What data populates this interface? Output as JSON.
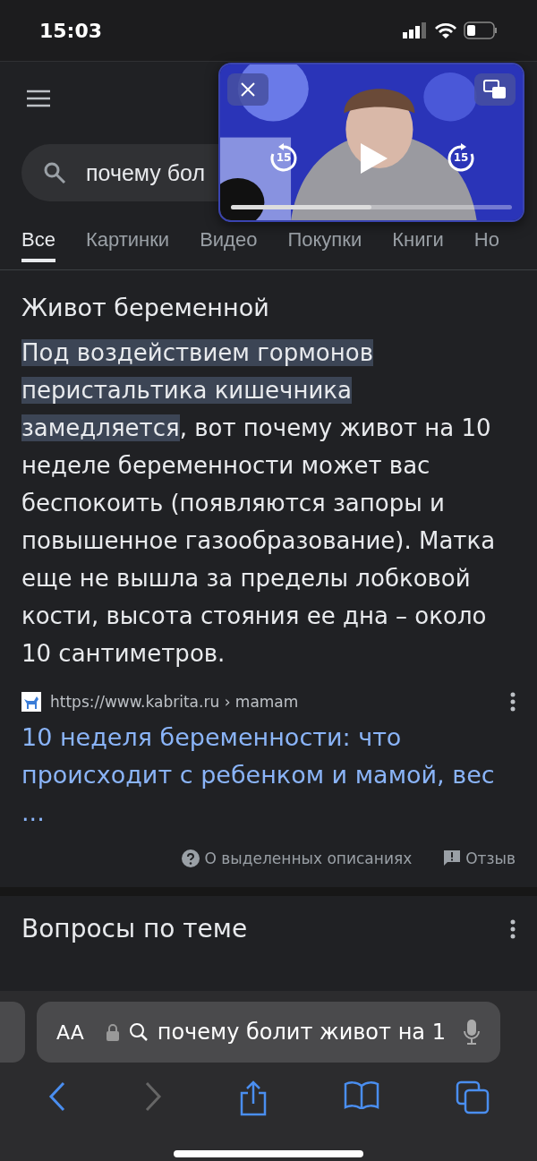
{
  "status_bar": {
    "time": "15:03"
  },
  "search": {
    "value": "почему бол"
  },
  "tabs": [
    {
      "label": "Все",
      "selected": true
    },
    {
      "label": "Картинки",
      "selected": false
    },
    {
      "label": "Видео",
      "selected": false
    },
    {
      "label": "Покупки",
      "selected": false
    },
    {
      "label": "Книги",
      "selected": false
    },
    {
      "label": "Но",
      "selected": false
    }
  ],
  "snippet": {
    "title": "Живот беременной",
    "highlight": "Под воздействием гормонов перистальтика кишечника замедляется",
    "text": ", вот почему живот на 10 неделе беременности может вас беспокоить (появляются запоры и повышенное газообразование). Матка еще не вышла за пределы лобковой кости, высота стояния ее дна – около 10 сантиметров.",
    "source": {
      "url": "https://www.kabrita.ru",
      "path": "› mamam"
    },
    "link": "10 неделя беременности: что происходит с ребенком и мамой, вес ...",
    "about": "О выделенных описаниях",
    "feedback": "Отзыв"
  },
  "related": {
    "title": "Вопросы по теме"
  },
  "video": {
    "skip_back": "15",
    "skip_forward": "15",
    "progress": {
      "level": 0.5
    }
  },
  "address_bar": {
    "text_size": "AA",
    "value": "почему болит живот на 1"
  },
  "toolbar": [
    {
      "kind": "back",
      "disabled": false
    },
    {
      "kind": "forward",
      "disabled": true
    },
    {
      "kind": "share",
      "disabled": false
    },
    {
      "kind": "bookmarks",
      "disabled": false
    },
    {
      "kind": "tabs",
      "disabled": false
    }
  ]
}
